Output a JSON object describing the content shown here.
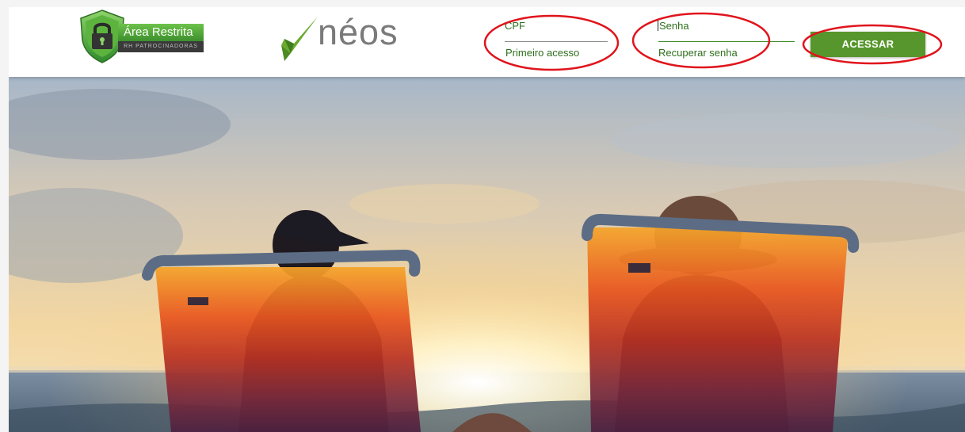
{
  "header": {
    "area_restrita": {
      "title": "Área Restrita",
      "subtitle": "RH PATROCINADORAS",
      "icon": "shield-lock-icon"
    },
    "brand": {
      "name": "néos",
      "icon": "checkmark-icon"
    },
    "login": {
      "cpf": {
        "label": "CPF",
        "link": "Primeiro acesso"
      },
      "senha": {
        "label": "Senha",
        "link": "Recuperar senha"
      },
      "submit_label": "ACESSAR"
    }
  },
  "hero": {
    "description_icon": "beach-sunset-photo"
  },
  "colors": {
    "brand_green": "#57962c",
    "text_green": "#2e6f1c",
    "annotation_red": "#e0141c"
  }
}
